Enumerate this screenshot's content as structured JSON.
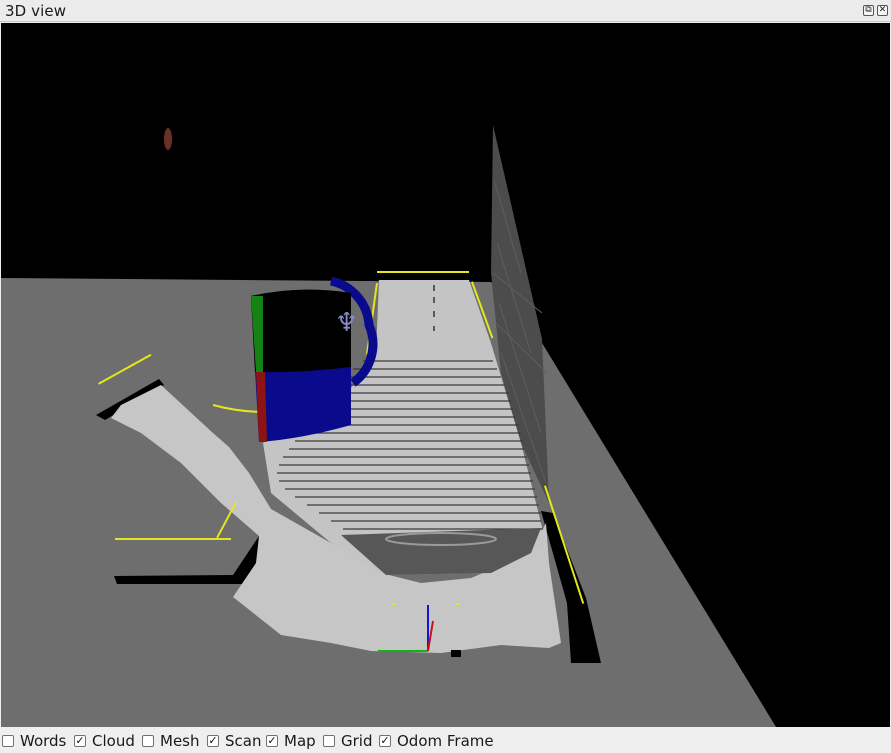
{
  "window": {
    "title": "3D view",
    "float_glyph": "⧉",
    "close_glyph": "✕"
  },
  "toolbar": {
    "checkboxes": [
      {
        "label": "Words",
        "checked": false
      },
      {
        "label": "Cloud",
        "checked": true
      },
      {
        "label": "Mesh",
        "checked": false
      },
      {
        "label": "Scan",
        "checked": true
      },
      {
        "label": "Map",
        "checked": true
      },
      {
        "label": "Grid",
        "checked": false
      },
      {
        "label": "Odom Frame",
        "checked": true
      }
    ]
  },
  "scene": {
    "background_color": "#000000",
    "floor_color": "#6e6e6e",
    "map_free_color": "#c8c8c8",
    "obstacle_color": "#000000",
    "scan_color": "#e6e61e",
    "mug_color": "#0a0a8c",
    "axis_x_color": "#c81414",
    "axis_y_color": "#14b414",
    "axis_z_color": "#1414dc"
  }
}
